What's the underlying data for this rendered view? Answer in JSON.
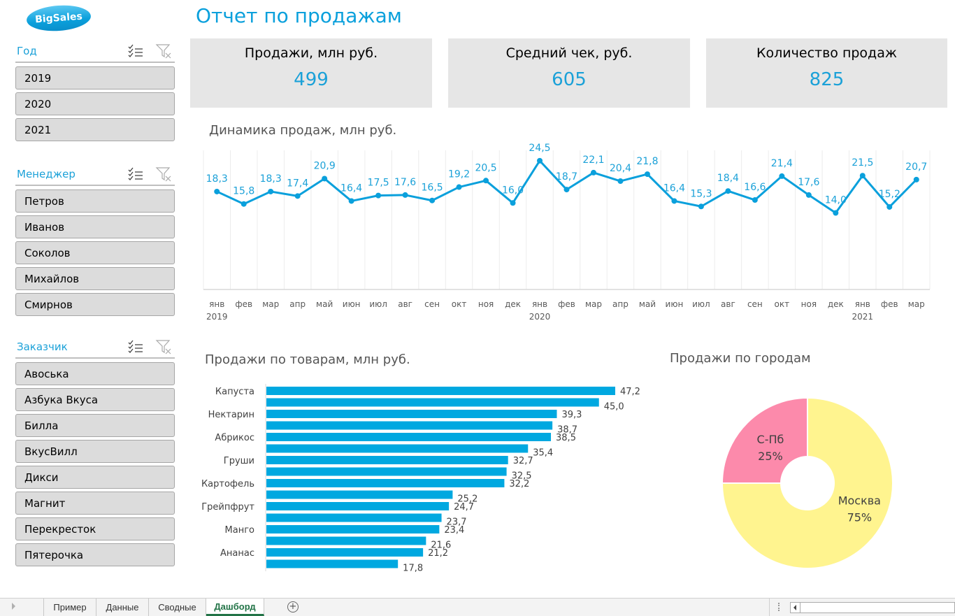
{
  "logo": {
    "text": "BigSales"
  },
  "page_title": "Отчет по продажам",
  "slicers": [
    {
      "title": "Год",
      "items": [
        "2019",
        "2020",
        "2021"
      ]
    },
    {
      "title": "Менеджер",
      "items": [
        "Петров",
        "Иванов",
        "Соколов",
        "Михайлов",
        "Смирнов"
      ]
    },
    {
      "title": "Заказчик",
      "items": [
        "Авоська",
        "Азбука Вкуса",
        "Билла",
        "ВкусВилл",
        "Дикси",
        "Магнит",
        "Перекресток",
        "Пятерочка"
      ]
    }
  ],
  "kpis": [
    {
      "label": "Продажи, млн руб.",
      "value": "499"
    },
    {
      "label": "Средний чек, руб.",
      "value": "605"
    },
    {
      "label": "Количество продаж",
      "value": "825"
    }
  ],
  "colors": {
    "accent": "#0aa0dc",
    "bar": "#00a8e0",
    "moscow": "#fff48f",
    "spb": "#fc8aab",
    "tab_active": "#217346"
  },
  "chart_data": [
    {
      "type": "line",
      "title": "Динамика продаж, млн руб.",
      "categories": [
        "янв",
        "фев",
        "мар",
        "апр",
        "май",
        "июн",
        "июл",
        "авг",
        "сен",
        "окт",
        "ноя",
        "дек",
        "янв",
        "фев",
        "мар",
        "апр",
        "май",
        "июн",
        "июл",
        "авг",
        "сен",
        "окт",
        "ноя",
        "дек",
        "янв",
        "фев",
        "мар"
      ],
      "year_labels": [
        {
          "index": 0,
          "label": "2019"
        },
        {
          "index": 12,
          "label": "2020"
        },
        {
          "index": 24,
          "label": "2021"
        }
      ],
      "values": [
        18.3,
        15.8,
        18.3,
        17.4,
        20.9,
        16.4,
        17.5,
        17.6,
        16.5,
        19.2,
        20.5,
        16.0,
        24.5,
        18.7,
        22.1,
        20.4,
        21.8,
        16.4,
        15.3,
        18.4,
        16.6,
        21.4,
        17.6,
        14.0,
        21.5,
        15.2,
        20.7
      ],
      "value_labels": [
        "18,3",
        "15,8",
        "18,3",
        "17,4",
        "20,9",
        "16,4",
        "17,5",
        "17,6",
        "16,5",
        "19,2",
        "20,5",
        "16,0",
        "24,5",
        "18,7",
        "22,1",
        "20,4",
        "21,8",
        "16,4",
        "15,3",
        "18,4",
        "16,6",
        "21,4",
        "17,6",
        "14,0",
        "21,5",
        "15,2",
        "20,7"
      ],
      "ylim": [
        0,
        28
      ],
      "grid": "vertical"
    },
    {
      "type": "bar",
      "orientation": "horizontal",
      "title": "Продажи по товарам, млн руб.",
      "categories": [
        "Капуста",
        "",
        "Нектарин",
        "",
        "Абрикос",
        "",
        "Груши",
        "",
        "Картофель",
        "",
        "Грейпфрут",
        "",
        "Манго",
        "",
        "Ананас",
        ""
      ],
      "values": [
        47.2,
        45.0,
        39.3,
        38.7,
        38.5,
        35.4,
        32.7,
        32.5,
        32.2,
        25.2,
        24.7,
        23.7,
        23.4,
        21.6,
        21.2,
        17.8
      ],
      "value_labels": [
        "47,2",
        "45,0",
        "39,3",
        "38,7",
        "38,5",
        "35,4",
        "32,7",
        "32,5",
        "32,2",
        "25,2",
        "24,7",
        "23,7",
        "23,4",
        "21,6",
        "21,2",
        "17,8"
      ],
      "xlim": [
        0,
        50
      ]
    },
    {
      "type": "pie",
      "subtype": "donut",
      "title": "Продажи по городам",
      "slices": [
        {
          "label": "Москва",
          "value": 75,
          "pct_label": "75%"
        },
        {
          "label": "С-Пб",
          "value": 25,
          "pct_label": "25%"
        }
      ]
    }
  ],
  "sheet_tabs": [
    {
      "label": "Пример",
      "active": false
    },
    {
      "label": "Данные",
      "active": false
    },
    {
      "label": "Сводные",
      "active": false
    },
    {
      "label": "Дашборд",
      "active": true
    }
  ]
}
